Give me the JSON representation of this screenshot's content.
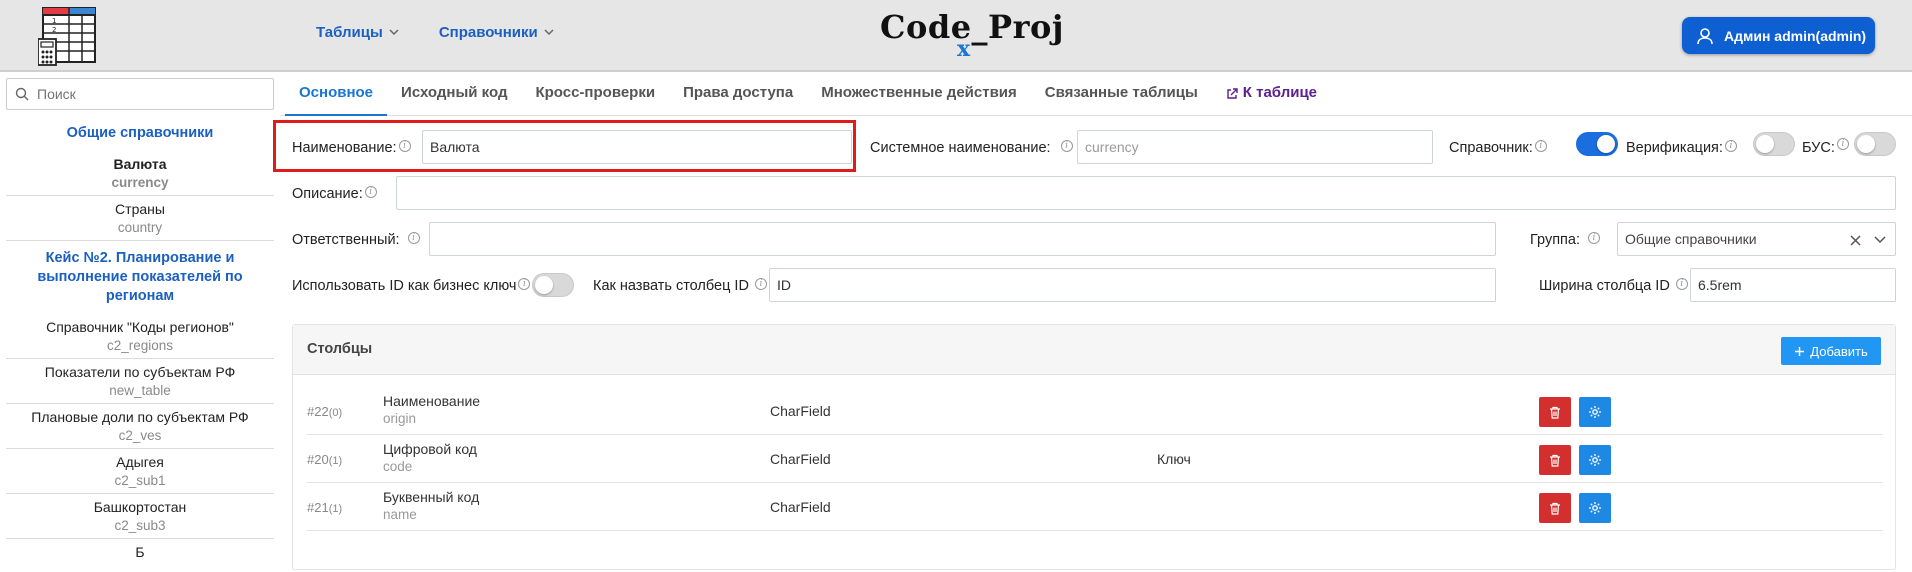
{
  "header": {
    "nav": [
      {
        "label": "Таблицы"
      },
      {
        "label": "Справочники"
      }
    ],
    "brand": "Code_Proj",
    "brand_mark": "x",
    "user_label": "Админ admin(admin)"
  },
  "sidebar": {
    "search_placeholder": "Поиск",
    "group1": "Общие справочники",
    "items1": [
      {
        "title": "Валюта",
        "sub": "currency"
      },
      {
        "title": "Страны",
        "sub": "country"
      }
    ],
    "group2": "Кейс №2. Планирование и выполнение показателей по регионам",
    "items2": [
      {
        "title": "Справочник \"Коды регионов\"",
        "sub": "c2_regions"
      },
      {
        "title": "Показатели по субъектам РФ",
        "sub": "new_table"
      },
      {
        "title": "Плановые доли по субъектам РФ",
        "sub": "c2_ves"
      },
      {
        "title": "Адыгея",
        "sub": "c2_sub1"
      },
      {
        "title": "Башкортостан",
        "sub": "c2_sub3"
      },
      {
        "title": "Б",
        "sub": ""
      }
    ]
  },
  "tabs": {
    "t0": "Основное",
    "t1": "Исходный код",
    "t2": "Кросс-проверки",
    "t3": "Права доступа",
    "t4": "Множественные действия",
    "t5": "Связанные таблицы",
    "t6": "К таблице"
  },
  "form": {
    "name_label": "Наименование:",
    "name_value": "Валюта",
    "sysname_label": "Системное наименование:",
    "sysname_value": "currency",
    "dict_label": "Справочник:",
    "dict_on": true,
    "verif_label": "Верификация:",
    "verif_on": false,
    "bus_label": "БУС:",
    "bus_on": false,
    "desc_label": "Описание:",
    "desc_value": "",
    "resp_label": "Ответственный:",
    "resp_value": "",
    "group_label": "Группа:",
    "group_value": "Общие справочники",
    "useid_label": "Использовать ID как бизнес ключ",
    "useid_on": false,
    "idname_label": "Как назвать столбец ID",
    "idname_value": "ID",
    "idwidth_label": "Ширина столбца ID",
    "idwidth_value": "6.5rem"
  },
  "columns": {
    "title": "Столбцы",
    "add_label": "Добавить",
    "rows": [
      {
        "num": "#22",
        "count": "(0)",
        "name": "Наименование",
        "code": "origin",
        "type": "CharField",
        "key": ""
      },
      {
        "num": "#20",
        "count": "(1)",
        "name": "Цифровой код",
        "code": "code",
        "type": "CharField",
        "key": "Ключ"
      },
      {
        "num": "#21",
        "count": "(1)",
        "name": "Буквенный код",
        "code": "name",
        "type": "CharField",
        "key": ""
      }
    ]
  },
  "colors": {
    "accent": "#1976d2",
    "danger": "#d32f2f",
    "highlight": "#e01b1b"
  }
}
